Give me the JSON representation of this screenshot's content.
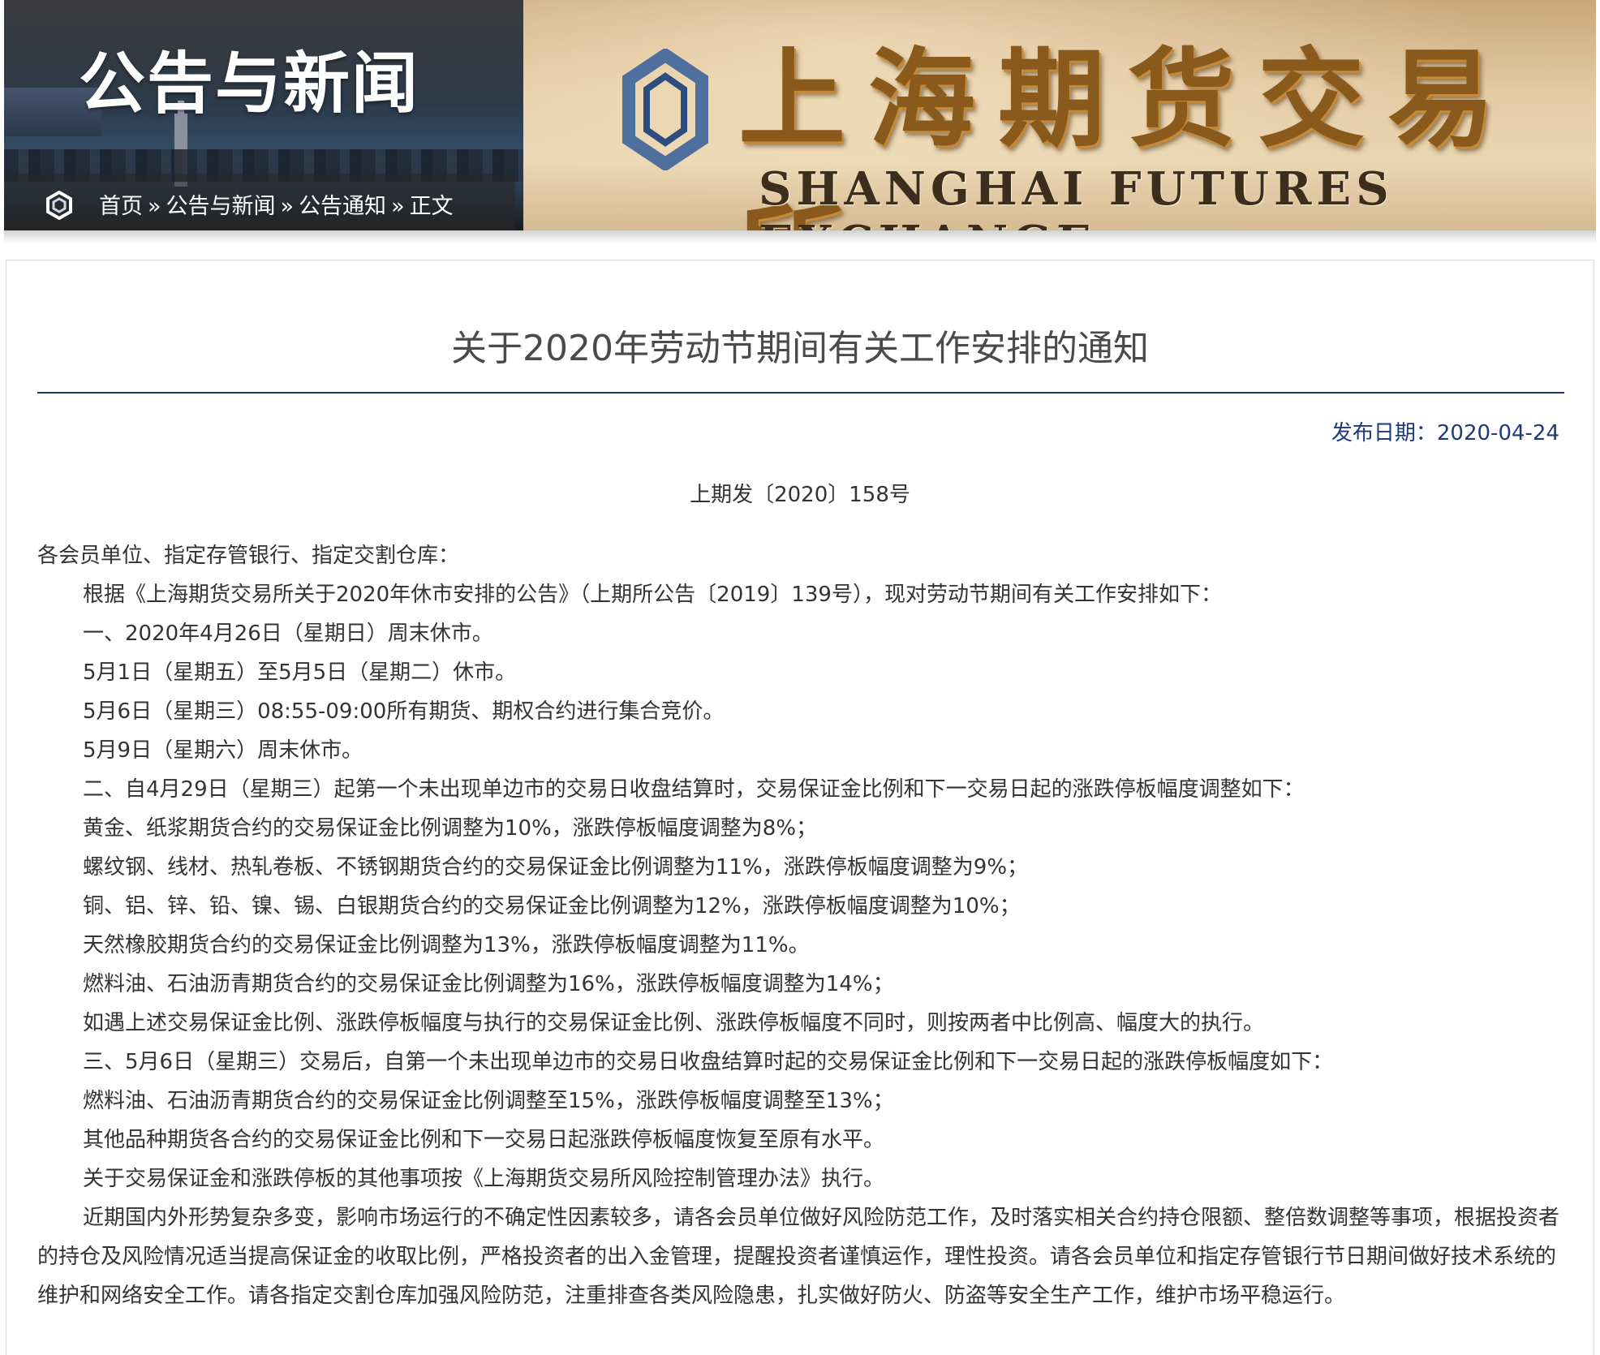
{
  "banner": {
    "section_title": "公告与新闻",
    "exchange_name_cn": "上海期货交易所",
    "exchange_name_en": "SHANGHAI FUTURES EXCHANGE"
  },
  "breadcrumb": {
    "items": [
      "首页",
      "公告与新闻",
      "公告通知",
      "正文"
    ],
    "separator": "»"
  },
  "article": {
    "title": "关于2020年劳动节期间有关工作安排的通知",
    "publish_date": "发布日期：2020-04-24",
    "doc_number": "上期发〔2020〕158号",
    "salutation": "各会员单位、指定存管银行、指定交割仓库：",
    "paragraphs": [
      "根据《上海期货交易所关于2020年休市安排的公告》（上期所公告〔2019〕139号），现对劳动节期间有关工作安排如下：",
      "一、2020年4月26日（星期日）周末休市。",
      "5月1日（星期五）至5月5日（星期二）休市。",
      "5月6日（星期三）08:55-09:00所有期货、期权合约进行集合竞价。",
      "5月9日（星期六）周末休市。",
      "二、自4月29日（星期三）起第一个未出现单边市的交易日收盘结算时，交易保证金比例和下一交易日起的涨跌停板幅度调整如下：",
      "黄金、纸浆期货合约的交易保证金比例调整为10%，涨跌停板幅度调整为8%；",
      "螺纹钢、线材、热轧卷板、不锈钢期货合约的交易保证金比例调整为11%，涨跌停板幅度调整为9%；",
      "铜、铝、锌、铅、镍、锡、白银期货合约的交易保证金比例调整为12%，涨跌停板幅度调整为10%；",
      "天然橡胶期货合约的交易保证金比例调整为13%，涨跌停板幅度调整为11%。",
      "燃料油、石油沥青期货合约的交易保证金比例调整为16%，涨跌停板幅度调整为14%；",
      "如遇上述交易保证金比例、涨跌停板幅度与执行的交易保证金比例、涨跌停板幅度不同时，则按两者中比例高、幅度大的执行。",
      "三、5月6日（星期三）交易后，自第一个未出现单边市的交易日收盘结算时起的交易保证金比例和下一交易日起的涨跌停板幅度如下：",
      "燃料油、石油沥青期货合约的交易保证金比例调整至15%，涨跌停板幅度调整至13%；",
      "其他品种期货各合约的交易保证金比例和下一交易日起涨跌停板幅度恢复至原有水平。",
      "关于交易保证金和涨跌停板的其他事项按《上海期货交易所风险控制管理办法》执行。",
      "近期国内外形势复杂多变，影响市场运行的不确定性因素较多，请各会员单位做好风险防范工作，及时落实相关合约持仓限额、整倍数调整等事项，根据投资者的持仓及风险情况适当提高保证金的收取比例，严格投资者的出入金管理，提醒投资者谨慎运作，理性投资。请各会员单位和指定存管银行节日期间做好技术系统的维护和网络安全工作。请各指定交割仓库加强风险防范，注重排查各类风险隐患，扎实做好防火、防盗等安全生产工作，维护市场平稳运行。"
    ]
  },
  "colors": {
    "accent_blue": "#1f3a78",
    "rule_blue": "#223a72",
    "text": "#333333",
    "title_text": "#4a4a4a"
  },
  "icons": {
    "breadcrumb_icon": "shfe-logo-icon",
    "banner_logo": "shfe-logo-icon"
  }
}
